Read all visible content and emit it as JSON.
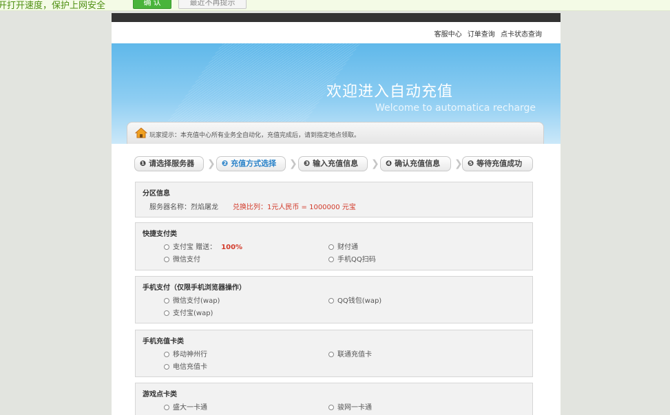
{
  "notice": {
    "text": "开打开速度，保护上网安全",
    "confirm_label": "确 认",
    "dismiss_label": "最近不再提示"
  },
  "header": {
    "links": [
      "客服中心",
      "订单查询",
      "点卡状态查询"
    ]
  },
  "banner": {
    "title": "欢迎进入自动充值",
    "subtitle": "Welcome to automatica recharge",
    "tip": "玩家提示：本充值中心所有业务全自动化，充值完成后，请到指定地点领取。"
  },
  "steps": [
    {
      "label": "❶ 请选择服务器",
      "active": false
    },
    {
      "label": "❷ 充值方式选择",
      "active": true
    },
    {
      "label": "❸ 输入充值信息",
      "active": false
    },
    {
      "label": "❹ 确认充值信息",
      "active": false
    },
    {
      "label": "❺ 等待充值成功",
      "active": false
    }
  ],
  "zone": {
    "title": "分区信息",
    "server_label": "服务器名称：烈焰屠龙",
    "ratio_label": "兑换比列：1元人民币 = 1000000 元宝"
  },
  "quick_pay": {
    "title": "快捷支付类",
    "options": [
      "支付宝 赠送：",
      "财付通",
      "微信支付",
      "手机QQ扫码"
    ],
    "bonus": "100%"
  },
  "mobile_pay": {
    "title": "手机支付（仅限手机浏览器操作）",
    "options": [
      "微信支付(wap)",
      "QQ钱包(wap)",
      "支付宝(wap)"
    ]
  },
  "phone_card": {
    "title": "手机充值卡类",
    "options": [
      "移动神州行",
      "联通充值卡",
      "电信充值卡"
    ]
  },
  "game_card": {
    "title": "游戏点卡类",
    "options": [
      "盛大一卡通",
      "骏网一卡通"
    ]
  }
}
